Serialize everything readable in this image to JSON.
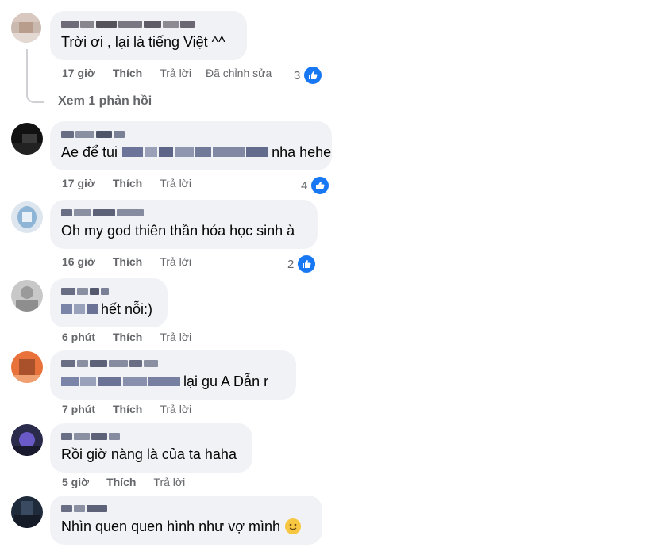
{
  "like_count_color": "#65676b",
  "comments": [
    {
      "text": "Trời ơi , lại là tiếng Việt ^^",
      "time": "17 giờ",
      "like": "Thích",
      "reply": "Trả lời",
      "edited": "Đã chỉnh sửa",
      "reactions": "3"
    },
    {
      "text_suffix": "nha hehe",
      "text_prefix": "Ae để tui",
      "time": "17 giờ",
      "like": "Thích",
      "reply": "Trả lời",
      "reactions": "4"
    },
    {
      "text": "Oh my god thiên thần hóa học sinh à",
      "time": "16 giờ",
      "like": "Thích",
      "reply": "Trả lời",
      "reactions": "2"
    },
    {
      "text_suffix": "hết nỗi:)",
      "time": "6 phút",
      "like": "Thích",
      "reply": "Trả lời"
    },
    {
      "text_suffix": "lại gu A Dẫn r",
      "time": "7 phút",
      "like": "Thích",
      "reply": "Trả lời"
    },
    {
      "text": "Rồi giờ nàng là của ta haha",
      "time": "5 giờ",
      "like": "Thích",
      "reply": "Trả lời"
    },
    {
      "text": "Nhìn quen quen hình như vợ mình",
      "time": "",
      "like": "",
      "reply": ""
    }
  ],
  "view_replies": "Xem 1 phản hồi"
}
